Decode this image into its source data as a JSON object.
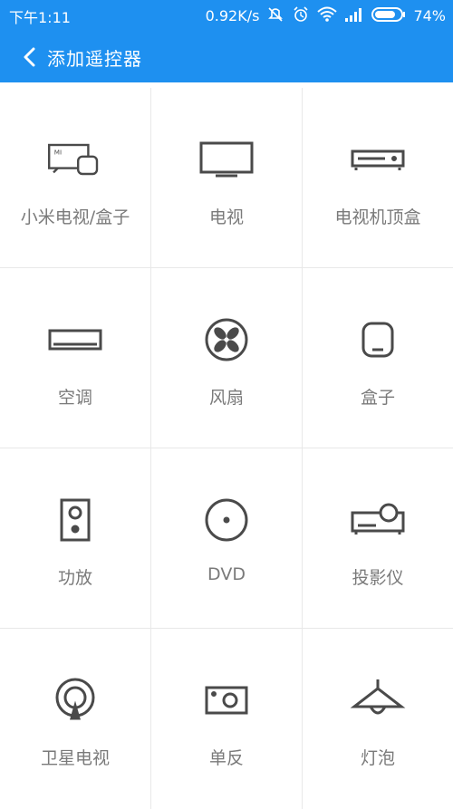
{
  "status": {
    "time": "下午1:11",
    "speed": "0.92K/s",
    "battery": "74%"
  },
  "app": {
    "title": "添加遥控器"
  },
  "devices": [
    {
      "label": "小米电视/盒子",
      "icon": "mi-tv-box-icon"
    },
    {
      "label": "电视",
      "icon": "tv-icon"
    },
    {
      "label": "电视机顶盒",
      "icon": "set-top-box-icon"
    },
    {
      "label": "空调",
      "icon": "air-conditioner-icon"
    },
    {
      "label": "风扇",
      "icon": "fan-icon"
    },
    {
      "label": "盒子",
      "icon": "box-icon"
    },
    {
      "label": "功放",
      "icon": "amplifier-icon"
    },
    {
      "label": "DVD",
      "icon": "dvd-icon"
    },
    {
      "label": "投影仪",
      "icon": "projector-icon"
    },
    {
      "label": "卫星电视",
      "icon": "satellite-tv-icon"
    },
    {
      "label": "单反",
      "icon": "dslr-camera-icon"
    },
    {
      "label": "灯泡",
      "icon": "light-bulb-icon"
    }
  ],
  "colors": {
    "primary": "#1e90f0",
    "icon": "#4a4a4a",
    "label": "#7a7a7a",
    "divider": "#e8e8e8"
  }
}
